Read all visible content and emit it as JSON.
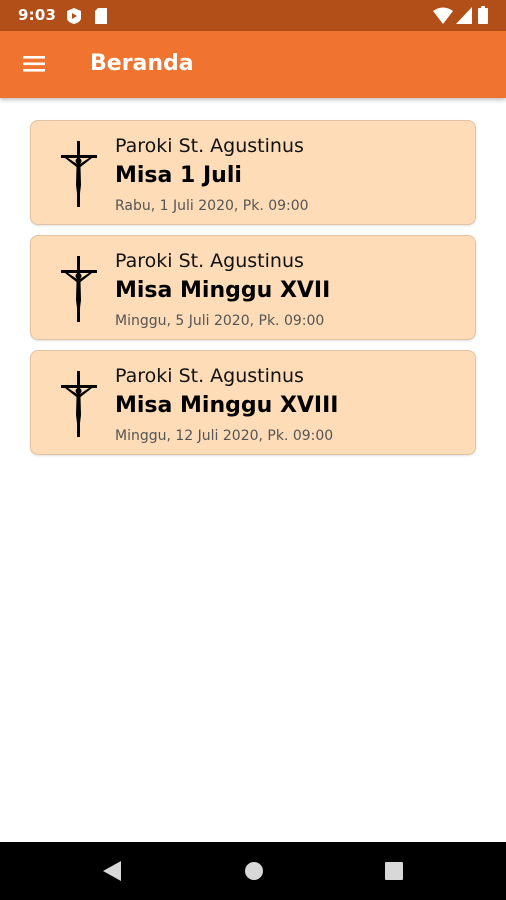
{
  "status_bar": {
    "time": "9:03",
    "icons": [
      "media-play-icon",
      "sd-card-icon",
      "wifi-icon",
      "signal-icon",
      "battery-icon"
    ]
  },
  "app_bar": {
    "title": "Beranda",
    "color": "#f07430",
    "menu_icon": "hamburger-menu-icon"
  },
  "masses": [
    {
      "parish": "Paroki St. Agustinus",
      "title": "Misa 1 Juli",
      "date": "Rabu, 1 Juli 2020, Pk. 09:00",
      "icon": "crucifix-icon"
    },
    {
      "parish": "Paroki St. Agustinus",
      "title": "Misa Minggu XVII",
      "date": "Minggu, 5 Juli 2020, Pk. 09:00",
      "icon": "crucifix-icon"
    },
    {
      "parish": "Paroki St. Agustinus",
      "title": "Misa Minggu XVIII",
      "date": "Minggu, 12 Juli 2020, Pk. 09:00",
      "icon": "crucifix-icon"
    }
  ],
  "nav_bar": {
    "buttons": [
      "back-icon",
      "home-icon",
      "recents-icon"
    ]
  },
  "colors": {
    "status_bar": "#b24f19",
    "card_bg": "#fddcb7",
    "card_border": "#e3c3a3"
  }
}
